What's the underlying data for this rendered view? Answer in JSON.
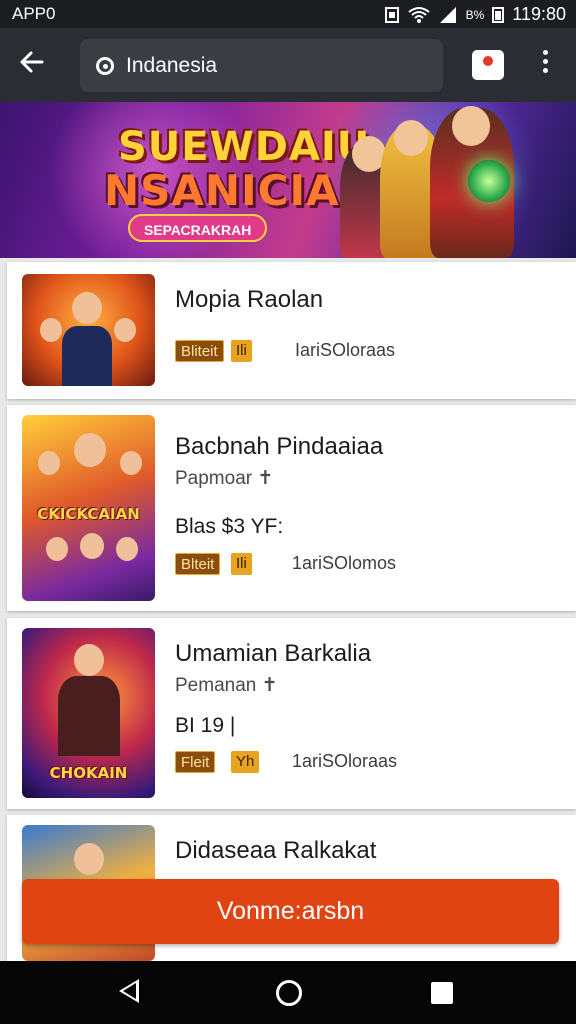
{
  "status_bar": {
    "app_label": "APP0",
    "battery_text": "B%",
    "time": "119:80"
  },
  "top_bar": {
    "back_icon": "arrow-left-icon",
    "search_text": "Indanesia",
    "notification_icon": "notification-icon",
    "more_icon": "more-vert-icon"
  },
  "banner": {
    "title_line1": "SUEWDAIU",
    "title_line2": "NSANICIA",
    "tagline": "ЅЕРАСRАKRАН"
  },
  "items": [
    {
      "title": "Mopia Raolan",
      "subtitle": "",
      "price": "",
      "badge1": "Bliteit",
      "badge2": "Ili",
      "meta": "IariSOloraas",
      "thumb_text": ""
    },
    {
      "title": "Bacbnah Pindaaiaa",
      "subtitle": "Papmoar ✝",
      "price": "Blas $3 YF:",
      "badge1": "Blteit",
      "badge2": "Ili",
      "meta": "1ariSOlomos",
      "thumb_text": "CKICKCAIAN"
    },
    {
      "title": "Umamian Barkalia",
      "subtitle": "Pemanan ✝",
      "price": "BI 19 |",
      "badge1": "Fleit",
      "badge2": "Yh",
      "meta": "1ariSOloraas",
      "thumb_text": "CHOKAIN"
    },
    {
      "title": "Didaseaa Ralkakat",
      "subtitle": "",
      "price": "",
      "badge1": "",
      "badge2": "",
      "meta": "",
      "thumb_text": ""
    }
  ],
  "cta": {
    "label": "Vonme:arsbn"
  },
  "nav": {
    "back_icon": "nav-back-icon",
    "home_icon": "nav-home-icon",
    "recent_icon": "nav-recent-icon"
  }
}
